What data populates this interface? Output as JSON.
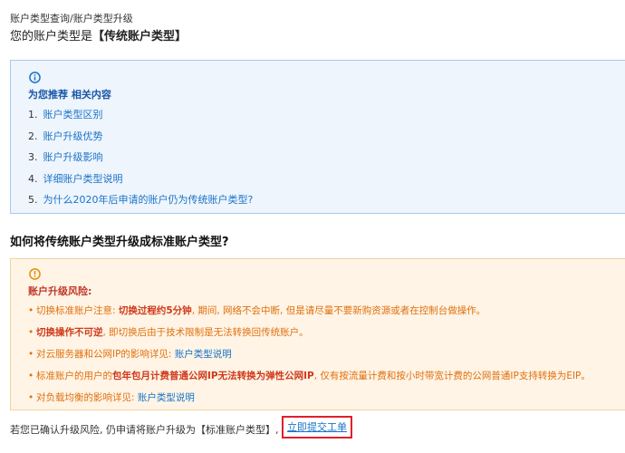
{
  "breadcrumb": "账户类型查询/账户类型升级",
  "account_type": {
    "prefix": "您的账户类型是",
    "value": "【传统账户类型】"
  },
  "recommend": {
    "icon": "info-icon",
    "title": "为您推荐 相关内容",
    "items": [
      {
        "num": "1.",
        "label": "账户类型区别"
      },
      {
        "num": "2.",
        "label": "账户升级优势"
      },
      {
        "num": "3.",
        "label": "账户升级影响"
      },
      {
        "num": "4.",
        "label": "详细账户类型说明"
      },
      {
        "num": "5.",
        "label": "为什么2020年后申请的账户仍为传统账户类型?"
      }
    ]
  },
  "upgrade_heading": "如何将传统账户类型升级成标准账户类型?",
  "risk": {
    "icon": "warning-icon",
    "title": "账户升级风险:",
    "items": [
      {
        "a": "切换标准账户注意: ",
        "b": "切换过程约5分钟",
        "c": ", 期间, 网络不会中断, 但是请尽量不要新购资源或者在控制台做操作。"
      },
      {
        "a": "",
        "b": "切换操作不可逆",
        "c": ", 即切换后由于技术限制是无法转换回传统账户。"
      },
      {
        "a": "对云服务器和公网IP的影响详见: ",
        "link": "账户类型说明"
      },
      {
        "a": "标准账户的用户的",
        "b": "包年包月计费普通公网IP无法转换为弹性公网IP",
        "c": ", 仅有按流量计费和按小时带宽计费的公网普通IP支持转换为EIP。"
      },
      {
        "a": "对负载均衡的影响详见: ",
        "link": "账户类型说明"
      }
    ]
  },
  "confirm_text": "若您已确认升级风险, 仍申请将账户升级为【标准账户类型】,",
  "ticket_button": "立即提交工单",
  "colors": {
    "info_bg": "#eef5fd",
    "info_border": "#a9c9ee",
    "warn_bg": "#fff4e5",
    "warn_border": "#f2d3a0",
    "link": "#1a73c7",
    "danger": "#d0391b",
    "warn_text": "#e0700e"
  }
}
